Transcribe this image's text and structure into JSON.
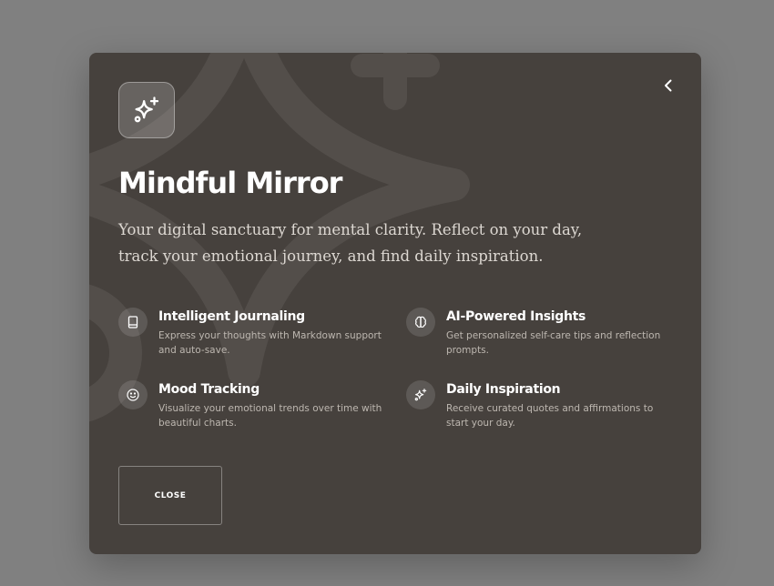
{
  "modal": {
    "title": "Mindful Mirror",
    "subtitle": "Your digital sanctuary for mental clarity. Reflect on your day, track your emotional journey, and find daily inspiration.",
    "logo_icon": "sparkles-icon",
    "back_icon": "chevron-left-icon",
    "features": [
      {
        "name": "Intelligent Journaling",
        "description": "Express your thoughts with Markdown support and auto-save.",
        "icon": "book-icon"
      },
      {
        "name": "AI-Powered Insights",
        "description": "Get personalized self-care tips and reflection prompts.",
        "icon": "brain-icon"
      },
      {
        "name": "Mood Tracking",
        "description": "Visualize your emotional trends over time with beautiful charts.",
        "icon": "smile-icon"
      },
      {
        "name": "Daily Inspiration",
        "description": "Receive curated quotes and affirmations to start your day.",
        "icon": "sparkles-icon"
      }
    ],
    "close_label": "CLOSE"
  },
  "colors": {
    "overlay": "#808080",
    "modal_background": "#46413d",
    "title": "#ffffff",
    "subtitle": "#ddd8d2",
    "description": "#bdb7b0"
  }
}
